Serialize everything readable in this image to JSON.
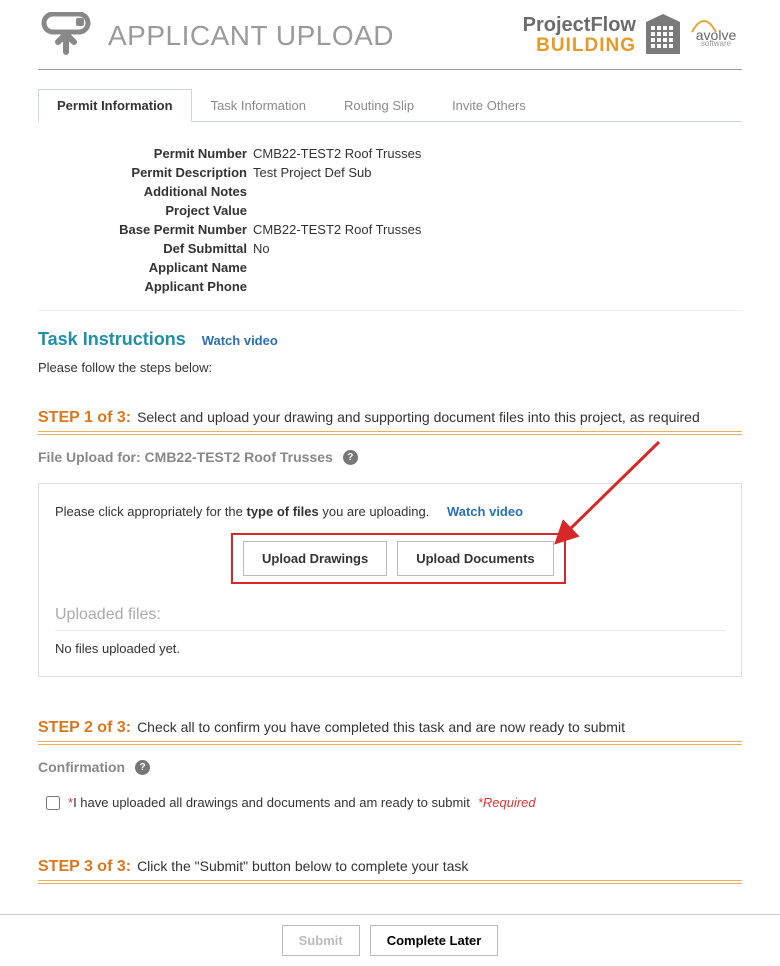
{
  "header": {
    "title": "APPLICANT UPLOAD",
    "brand_line1": "ProjectFlow",
    "brand_line2": "BUILDING",
    "avolve_top": "avolve",
    "avolve_bottom": "software"
  },
  "tabs": [
    {
      "label": "Permit Information",
      "active": true
    },
    {
      "label": "Task Information",
      "active": false
    },
    {
      "label": "Routing Slip",
      "active": false
    },
    {
      "label": "Invite Others",
      "active": false
    }
  ],
  "permit": {
    "number_label": "Permit Number",
    "number_value": "CMB22-TEST2 Roof Trusses",
    "desc_label": "Permit Description",
    "desc_value": "Test Project Def Sub",
    "notes_label": "Additional Notes",
    "notes_value": "",
    "value_label": "Project Value",
    "value_value": "",
    "base_label": "Base Permit Number",
    "base_value": "CMB22-TEST2 Roof Trusses",
    "def_label": "Def Submittal",
    "def_value": "No",
    "app_name_label": "Applicant Name",
    "app_name_value": "",
    "app_phone_label": "Applicant Phone",
    "app_phone_value": ""
  },
  "instructions": {
    "heading": "Task Instructions",
    "watch": "Watch video",
    "follow": "Please follow the steps below:"
  },
  "step1": {
    "label": "STEP 1 of 3:",
    "desc": "Select and upload your drawing and supporting document files into this project, as required",
    "upload_for": "File Upload for: CMB22-TEST2 Roof Trusses",
    "prompt_pre": "Please click appropriately for the ",
    "prompt_bold": "type of files",
    "prompt_post": " you are uploading.",
    "watch": "Watch video",
    "btn_drawings": "Upload Drawings",
    "btn_documents": "Upload Documents",
    "uploaded_label": "Uploaded files:",
    "no_files": "No files uploaded yet."
  },
  "step2": {
    "label": "STEP 2 of 3:",
    "desc": "Check all to confirm you have completed this task and are now ready to submit",
    "confirmation": "Confirmation",
    "check_text": "I have uploaded all drawings and documents and am ready to submit",
    "required": "*Required"
  },
  "step3": {
    "label": "STEP 3 of 3:",
    "desc": "Click the \"Submit\" button below to complete your task"
  },
  "footer": {
    "submit": "Submit",
    "later": "Complete Later"
  }
}
